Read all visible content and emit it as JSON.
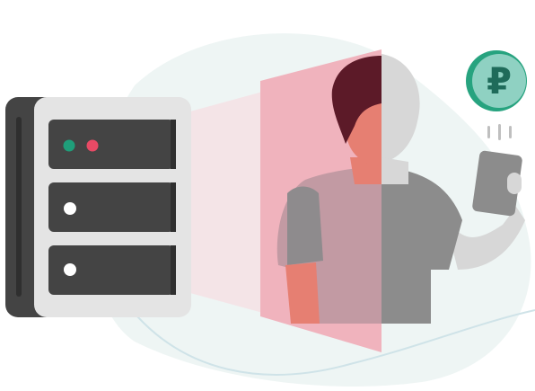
{
  "illustration": {
    "server_icon": "server-rack-icon",
    "person_icon": "person-with-phone-icon",
    "currency_icon": "ruble-coin-icon",
    "currency_symbol": "₽",
    "colors": {
      "background_blob": "#eef5f4",
      "server_dark": "#444444",
      "server_light": "#e4e4e4",
      "led_green": "#1f9e7a",
      "led_red": "#e84a65",
      "led_white": "#ffffff",
      "beam_light": "#f4e4e7",
      "beam_pink": "#f0b3bd",
      "person_gray": "#8c8c8c",
      "person_light": "#d7d7d7",
      "skin": "#e67f72",
      "hair": "#5c1a28",
      "coin_fill": "#8fd1c2",
      "coin_ring": "#27a37f",
      "coin_symbol": "#1f6b5a",
      "curve_line": "#cfe3e8"
    }
  }
}
